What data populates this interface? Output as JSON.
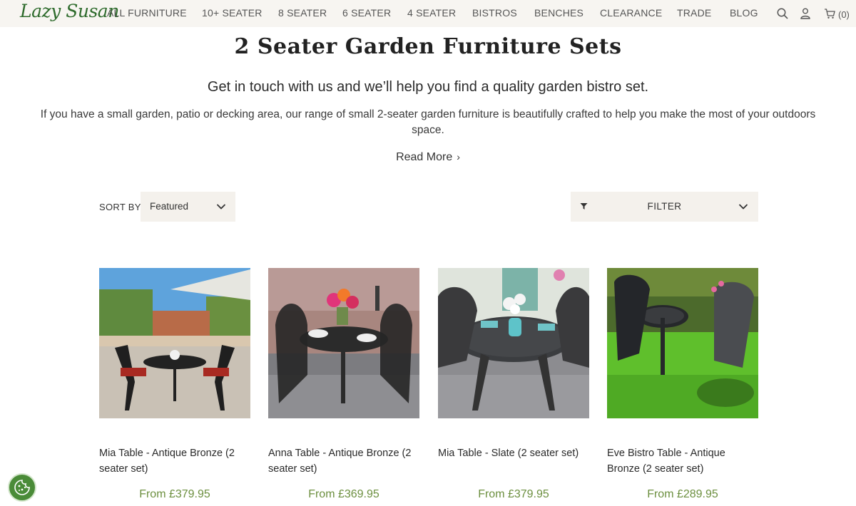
{
  "brand": {
    "logo_text": "Lazy Susan"
  },
  "nav": {
    "items": [
      "ALL FURNITURE",
      "10+ SEATER",
      "8 SEATER",
      "6 SEATER",
      "4 SEATER",
      "BISTROS",
      "BENCHES",
      "CLEARANCE",
      "TRADE",
      "BLOG"
    ],
    "cart_count": "(0)"
  },
  "intro": {
    "title": "2 Seater Garden Furniture Sets",
    "lead": "Get in touch with us and we’ll help you find a quality garden bistro set.",
    "description": "If you have a small garden, patio or decking area, our range of small 2-seater garden furniture is beautifully crafted to help you make the most of your outdoors space.",
    "read_more": "Read More"
  },
  "controls": {
    "sort_label": "SORT BY",
    "sort_value": "Featured",
    "filter_label": "FILTER"
  },
  "products": [
    {
      "name": "Mia Table - Antique Bronze (2 seater set)",
      "price": "From £379.95"
    },
    {
      "name": "Anna Table - Antique Bronze (2 seater set)",
      "price": "From £369.95"
    },
    {
      "name": "Mia Table - Slate (2 seater set)",
      "price": "From £379.95"
    },
    {
      "name": "Eve Bistro Table - Antique Bronze (2 seater set)",
      "price": "From £289.95"
    }
  ],
  "colors": {
    "brand_green": "#2e6b2c",
    "price_green": "#6c8f3f",
    "header_bg": "#f7f5f1",
    "control_bg": "#f4f1ec"
  },
  "icons": [
    "search-icon",
    "account-icon",
    "cart-icon",
    "chevron-down-icon",
    "filter-icon",
    "cookie-settings-icon"
  ]
}
